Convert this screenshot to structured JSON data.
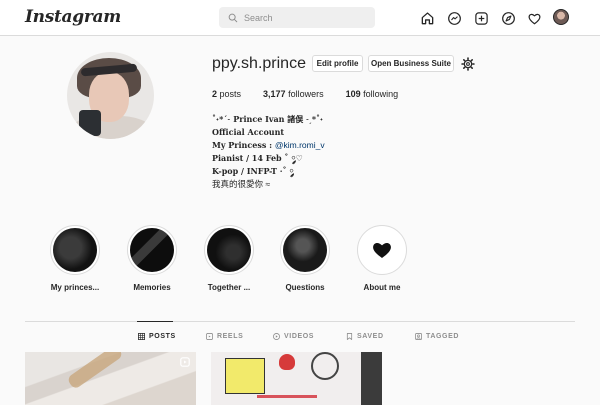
{
  "app": {
    "logo": "Instagram"
  },
  "search": {
    "placeholder": "Search"
  },
  "nav": {
    "icons": [
      "home-icon",
      "messenger-icon",
      "new-post-icon",
      "explore-icon",
      "activity-heart-icon",
      "profile-avatar"
    ]
  },
  "profile": {
    "username": "ppy.sh.prince",
    "edit_label": "Edit profile",
    "business_label": "Open Business Suite",
    "stats": {
      "posts_count": "2",
      "posts_label": " posts",
      "followers_count": "3,177",
      "followers_label": " followers",
      "following_count": "109",
      "following_label": " following"
    },
    "bio": {
      "line1": "˚˖*ˊ˗ Prince Ivan 諸俣 ˗ˏ*˚˖",
      "line2": "Official Account",
      "line3_prefix": "My Princess : ",
      "line3_mention": "@kim.romi_v",
      "line4": "Pianist / 14 Feb ˚ ༘♡",
      "line5": "K-pop / INFP-T ·˚ ༘",
      "line6": "我真的很愛你 ≈"
    }
  },
  "highlights": [
    {
      "label": "My princes..."
    },
    {
      "label": "Memories"
    },
    {
      "label": "Together ..."
    },
    {
      "label": "Questions"
    },
    {
      "label": "About me"
    }
  ],
  "tabs": [
    {
      "label": "POSTS",
      "icon": "grid-icon",
      "active": true
    },
    {
      "label": "REELS",
      "icon": "reels-icon",
      "active": false
    },
    {
      "label": "VIDEOS",
      "icon": "video-icon",
      "active": false
    },
    {
      "label": "SAVED",
      "icon": "bookmark-icon",
      "active": false
    },
    {
      "label": "TAGGED",
      "icon": "tagged-icon",
      "active": false
    }
  ],
  "colors": {
    "link": "#00376b",
    "border": "#dbdbdb",
    "text": "#262626",
    "muted": "#8e8e8e"
  }
}
